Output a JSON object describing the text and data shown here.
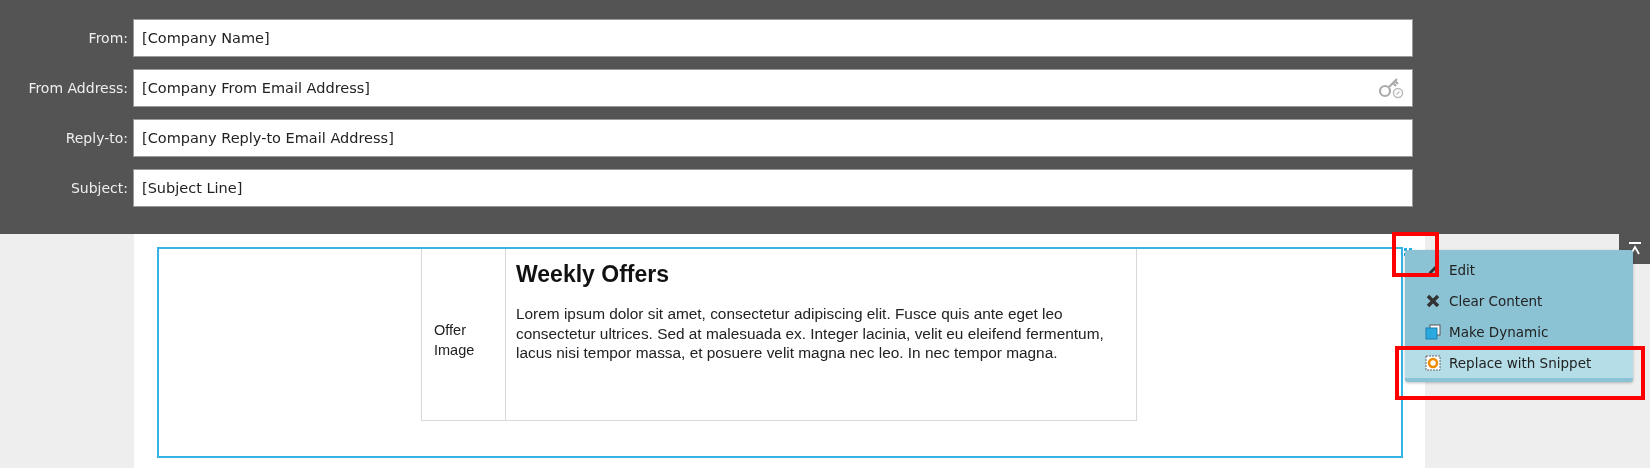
{
  "header_fields": [
    {
      "label": "From:",
      "value": "[Company Name]",
      "has_token_icon": false
    },
    {
      "label": "From Address:",
      "value": "[Company From Email Address]",
      "has_token_icon": true
    },
    {
      "label": "Reply-to:",
      "value": "[Company Reply-to Email Address]",
      "has_token_icon": false
    },
    {
      "label": "Subject:",
      "value": "[Subject Line]",
      "has_token_icon": false
    }
  ],
  "content_block": {
    "image_label": "Offer Image",
    "heading": "Weekly Offers",
    "body": "Lorem ipsum dolor sit amet, consectetur adipiscing elit. Fusce quis ante eget leo consectetur ultrices. Sed at malesuada ex. Integer lacinia, velit eu eleifend fermentum, lacus nisi tempor massa, et posuere velit magna nec leo. In nec tempor magna."
  },
  "context_menu": {
    "items": [
      {
        "kind": "edit",
        "label": "Edit",
        "selected": false
      },
      {
        "kind": "clear",
        "label": "Clear Content",
        "selected": false
      },
      {
        "kind": "dynamic",
        "label": "Make Dynamic",
        "selected": false
      },
      {
        "kind": "snippet",
        "label": "Replace with Snippet",
        "selected": true
      }
    ]
  }
}
